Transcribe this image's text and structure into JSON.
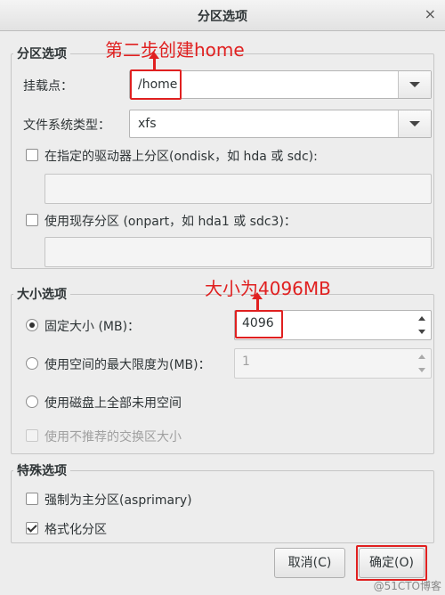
{
  "window": {
    "title": "分区选项",
    "close_glyph": "×"
  },
  "partition": {
    "legend": "分区选项",
    "mount_label": "挂载点：",
    "mount_value": "/home",
    "fs_label": "文件系统类型：",
    "fs_value": "xfs",
    "ondisk_label": "在指定的驱动器上分区(ondisk，如 hda 或 sdc):",
    "onpart_label": "使用现存分区 (onpart，如 hda1 或 sdc3)："
  },
  "size": {
    "legend": "大小选项",
    "fixed_label": "固定大小 (MB)：",
    "fixed_value": "4096",
    "max_label": "使用空间的最大限度为(MB)：",
    "max_value": "1",
    "all_label": "使用磁盘上全部未用空间",
    "swap_label": "使用不推荐的交换区大小"
  },
  "special": {
    "legend": "特殊选项",
    "primary_label": "强制为主分区(asprimary)",
    "format_label": "格式化分区"
  },
  "buttons": {
    "cancel": "取消(C)",
    "ok": "确定(O)"
  },
  "annotations": {
    "step2": "第二步创建home",
    "size_note": "大小为4096MB",
    "color": "#e02020"
  },
  "watermark": "@51CTO博客"
}
